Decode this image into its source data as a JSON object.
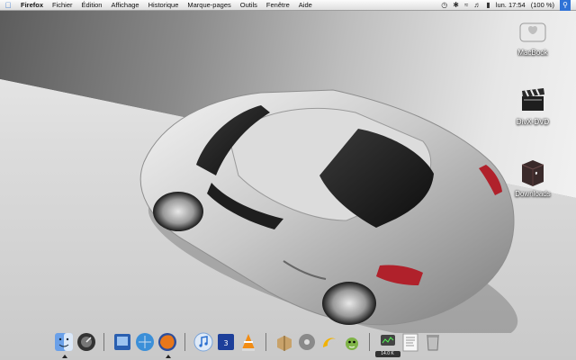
{
  "menubar": {
    "apple": "",
    "menus": [
      "Firefox",
      "Fichier",
      "Édition",
      "Affichage",
      "Historique",
      "Marque-pages",
      "Outils",
      "Fenêtre",
      "Aide"
    ],
    "clock": "lun. 17:54",
    "battery": "(100 %)",
    "status_icons": [
      "timemachine-icon",
      "bluetooth-icon",
      "wifi-icon",
      "volume-icon",
      "battery-icon",
      "spotlight-icon"
    ]
  },
  "desktop": {
    "icons": [
      {
        "label": "MacBook",
        "icon": "hard-drive-icon"
      },
      {
        "label": "DivX-DVD",
        "icon": "clapperboard-icon"
      },
      {
        "label": "Downloads",
        "icon": "folder-icon"
      }
    ]
  },
  "dock": {
    "items": [
      {
        "name": "finder",
        "running": true
      },
      {
        "name": "dashboard",
        "running": false
      },
      {
        "name": "ichat",
        "running": false
      },
      {
        "name": "safari",
        "running": false
      },
      {
        "name": "firefox",
        "running": true
      },
      {
        "name": "itunes",
        "running": false
      },
      {
        "name": "ical",
        "running": false
      },
      {
        "name": "vlc",
        "running": false
      },
      {
        "name": "installer",
        "running": false
      },
      {
        "name": "utilities",
        "running": false
      },
      {
        "name": "transmit",
        "running": false
      },
      {
        "name": "adium",
        "running": false
      },
      {
        "name": "activity-monitor",
        "running": true
      },
      {
        "name": "textedit",
        "running": false
      },
      {
        "name": "trash",
        "running": false
      }
    ],
    "activity_badge": "14.0 K"
  },
  "colors": {
    "accent": "#2a6fd0",
    "menubar_bg": "#f0f0f0",
    "taillight": "#b0212b"
  }
}
